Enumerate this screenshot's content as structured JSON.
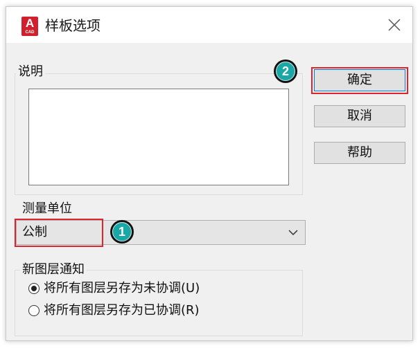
{
  "window": {
    "title": "样板选项",
    "app_icon_text": "A",
    "app_icon_subtext": "CAD",
    "close_icon": "close-icon"
  },
  "description": {
    "group_label": "说明",
    "text": ""
  },
  "buttons": {
    "ok": "确定",
    "cancel": "取消",
    "help": "帮助"
  },
  "measurement": {
    "label": "测量单位",
    "selected": "公制"
  },
  "new_layer_notification": {
    "group_label": "新图层通知",
    "options": [
      {
        "label": "将所有图层另存为未协调(U)",
        "checked": true
      },
      {
        "label": "将所有图层另存为已协调(R)",
        "checked": false
      }
    ]
  },
  "annotations": {
    "badge_1": "1",
    "badge_2": "2",
    "highlight_color": "#e0222c",
    "badge_color": "#1ba7a6"
  }
}
